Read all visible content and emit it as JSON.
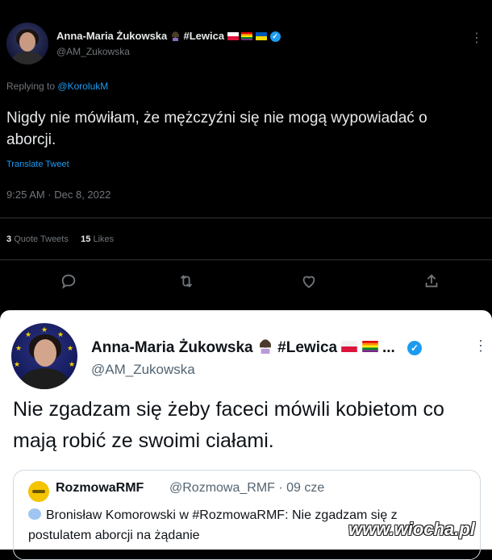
{
  "top_tweet": {
    "author_name": "Anna-Maria Żukowska",
    "hashtag": "#Lewica",
    "handle": "@AM_Zukowska",
    "replying_prefix": "Replying to",
    "replying_to": "@KorolukM",
    "text": "Nigdy nie mówiłam, że mężczyźni się nie mogą wypowiadać o aborcji.",
    "translate_label": "Translate Tweet",
    "timestamp": "9:25 AM · Dec 8, 2022",
    "quote_tweets_count": "3",
    "quote_tweets_label": "Quote Tweets",
    "likes_count": "15",
    "likes_label": "Likes",
    "actions": [
      "reply-icon",
      "retweet-icon",
      "like-icon",
      "share-icon"
    ]
  },
  "bottom_tweet": {
    "author_name": "Anna-Maria Żukowska",
    "hashtag": "#Lewica",
    "ellipsis": "...",
    "handle": "@AM_Zukowska",
    "text": "Nie zgadzam się żeby faceci mówili kobietom co mają robić ze swoimi ciałami.",
    "quoted": {
      "author_name": "RozmowaRMF",
      "handle_time": "@Rozmowa_RMF · 09 cze",
      "text": "Bronisław Komorowski w #RozmowaRMF: Nie zgadzam się z postulatem aborcji na żądanie"
    }
  },
  "watermark": "www.wiocha.pl",
  "colors": {
    "dark_bg": "#000000",
    "light_bg": "#ffffff",
    "accent": "#1d9bf0",
    "muted_dark": "#71767b",
    "muted_light": "#536471"
  }
}
